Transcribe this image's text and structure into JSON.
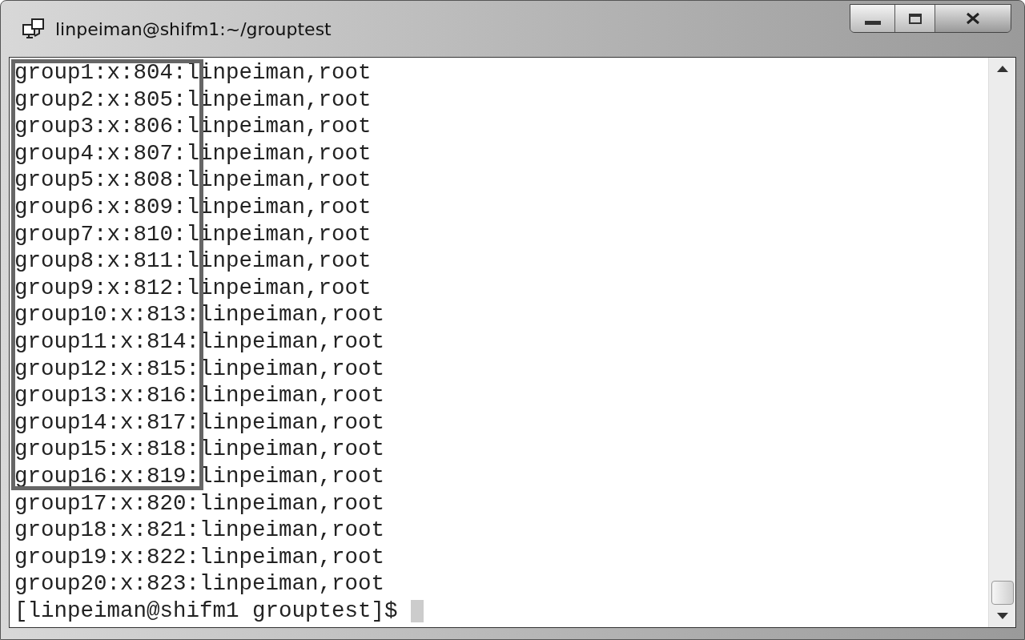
{
  "window": {
    "title": "linpeiman@shifm1:~/grouptest"
  },
  "terminal": {
    "lines": [
      {
        "text": "group1:x:804:linpeiman,root",
        "boxed": true
      },
      {
        "text": "group2:x:805:linpeiman,root",
        "boxed": true
      },
      {
        "text": "group3:x:806:linpeiman,root",
        "boxed": true
      },
      {
        "text": "group4:x:807:linpeiman,root",
        "boxed": true
      },
      {
        "text": "group5:x:808:linpeiman,root",
        "boxed": true
      },
      {
        "text": "group6:x:809:linpeiman,root",
        "boxed": true
      },
      {
        "text": "group7:x:810:linpeiman,root",
        "boxed": true
      },
      {
        "text": "group8:x:811:linpeiman,root",
        "boxed": true
      },
      {
        "text": "group9:x:812:linpeiman,root",
        "boxed": true
      },
      {
        "text": "group10:x:813:linpeiman,root",
        "boxed": true
      },
      {
        "text": "group11:x:814:linpeiman,root",
        "boxed": true
      },
      {
        "text": "group12:x:815:linpeiman,root",
        "boxed": true
      },
      {
        "text": "group13:x:816:linpeiman,root",
        "boxed": true
      },
      {
        "text": "group14:x:817:linpeiman,root",
        "boxed": true
      },
      {
        "text": "group15:x:818:linpeiman,root",
        "boxed": true
      },
      {
        "text": "group16:x:819:linpeiman,root",
        "boxed": true
      },
      {
        "text": "group17:x:820:linpeiman,root",
        "boxed": false
      },
      {
        "text": "group18:x:821:linpeiman,root",
        "boxed": false
      },
      {
        "text": "group19:x:822:linpeiman,root",
        "boxed": false
      },
      {
        "text": "group20:x:823:linpeiman,root",
        "boxed": false
      }
    ],
    "prompt": "[linpeiman@shifm1 grouptest]$"
  }
}
